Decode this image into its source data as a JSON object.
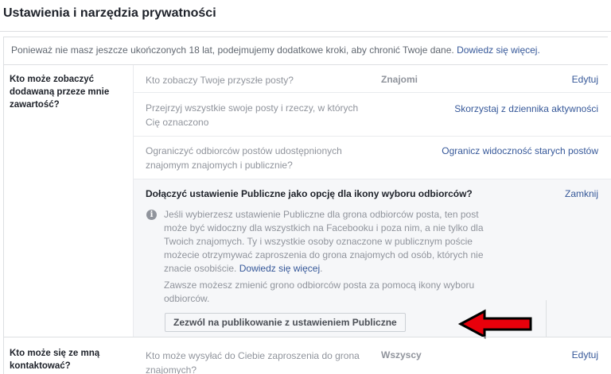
{
  "page": {
    "title": "Ustawienia i narzędzia prywatności"
  },
  "notice": {
    "text": "Ponieważ nie masz jeszcze ukończonych 18 lat, podejmujemy dodatkowe kroki, aby chronić Twoje dane.",
    "link": "Dowiedz się więcej."
  },
  "sections": [
    {
      "label": "Kto może zobaczyć dodawaną przeze mnie zawartość?",
      "rows": [
        {
          "question": "Kto zobaczy Twoje przyszłe posty?",
          "value": "Znajomi",
          "action": "Edytuj"
        },
        {
          "question": "Przejrzyj wszystkie swoje posty i rzeczy, w których Cię oznaczono",
          "value": "",
          "action": "Skorzystaj z dziennika aktywności"
        },
        {
          "question": "Ograniczyć odbiorców postów udostępnionych znajomym znajomych i publicznie?",
          "value": "",
          "action": "Ogranicz widoczność starych postów"
        }
      ],
      "expanded": {
        "title": "Dołączyć ustawienie Publiczne jako opcję dla ikony wyboru odbiorców?",
        "close": "Zamknij",
        "info_icon": "info-icon",
        "body": "Jeśli wybierzesz ustawienie Publiczne dla grona odbiorców posta, ten post może być widoczny dla wszystkich na Facebooku i poza nim, a nie tylko dla Twoich znajomych. Ty i wszystkie osoby oznaczone w publicznym poście możecie otrzymywać zaproszenia do grona znajomych od osób, których nie znacie osobiście.",
        "body_link": "Dowiedz się więcej",
        "body_end": ".",
        "note": "Zawsze możesz zmienić grono odbiorców posta za pomocą ikony wyboru odbiorców.",
        "button": "Zezwól na publikowanie z ustawieniem Publiczne"
      }
    },
    {
      "label": "Kto może się ze mną kontaktować?",
      "rows": [
        {
          "question": "Kto może wysyłać do Ciebie zaproszenia do grona znajomych?",
          "value": "Wszyscy",
          "action": "Edytuj"
        }
      ]
    }
  ],
  "colors": {
    "link": "#365899",
    "muted": "#90949c",
    "arrow_fill": "#e8000b"
  }
}
